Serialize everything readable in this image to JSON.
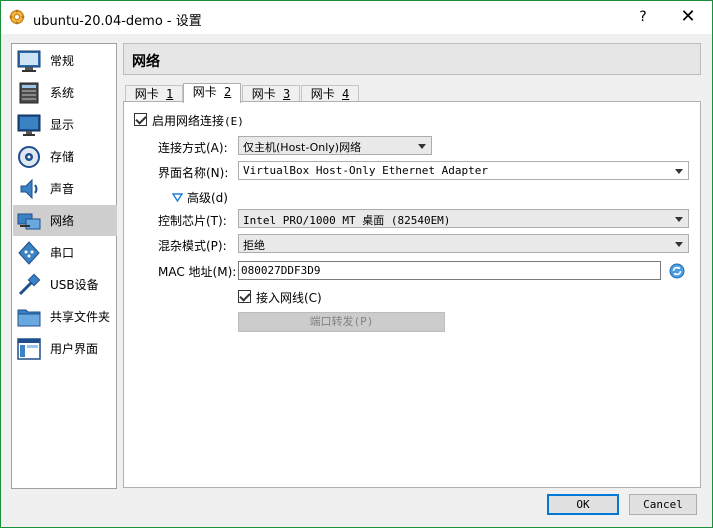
{
  "window": {
    "title": "ubuntu-20.04-demo - 设置",
    "help_label": "?",
    "close_label": "✕"
  },
  "sidebar": {
    "items": [
      {
        "label": "常规",
        "icon": "general-icon"
      },
      {
        "label": "系统",
        "icon": "system-icon"
      },
      {
        "label": "显示",
        "icon": "display-icon"
      },
      {
        "label": "存储",
        "icon": "storage-icon"
      },
      {
        "label": "声音",
        "icon": "audio-icon"
      },
      {
        "label": "网络",
        "icon": "network-icon",
        "active": true
      },
      {
        "label": "串口",
        "icon": "serial-port-icon"
      },
      {
        "label": "USB设备",
        "icon": "usb-icon"
      },
      {
        "label": "共享文件夹",
        "icon": "shared-folder-icon"
      },
      {
        "label": "用户界面",
        "icon": "user-interface-icon"
      }
    ]
  },
  "section_title": "网络",
  "tabs": [
    {
      "label": "网卡 1",
      "prefix": "网卡 ",
      "num": "1"
    },
    {
      "label": "网卡 2",
      "prefix": "网卡 ",
      "num": "2",
      "active": true
    },
    {
      "label": "网卡 3",
      "prefix": "网卡 ",
      "num": "3"
    },
    {
      "label": "网卡 4",
      "prefix": "网卡 ",
      "num": "4"
    }
  ],
  "adapter": {
    "enable_label": "启用网络连接(E)",
    "enable_text": "启用网络连接",
    "enable_key": "(E)",
    "enable_checked": true,
    "attached_to_label": "连接方式(A):",
    "attached_to_value": "仅主机(Host-Only)网络",
    "name_label": "界面名称(N):",
    "name_value": "VirtualBox Host-Only Ethernet Adapter",
    "advanced_label": "高级(d)",
    "adapter_type_label": "控制芯片(T):",
    "adapter_type_value": "Intel PRO/1000 MT 桌面 (82540EM)",
    "promiscuous_label": "混杂模式(P):",
    "promiscuous_value": "拒绝",
    "mac_label": "MAC 地址(M):",
    "mac_value": "080027DDF3D9",
    "cable_label": "接入网线(C)",
    "cable_checked": true,
    "port_forwarding_label": "端口转发(P)"
  },
  "buttons": {
    "ok": "OK",
    "cancel": "Cancel"
  },
  "colors": {
    "accent": "#0078d7",
    "active_nav": "#cfcfcf",
    "window_border": "#1c8f3c"
  }
}
